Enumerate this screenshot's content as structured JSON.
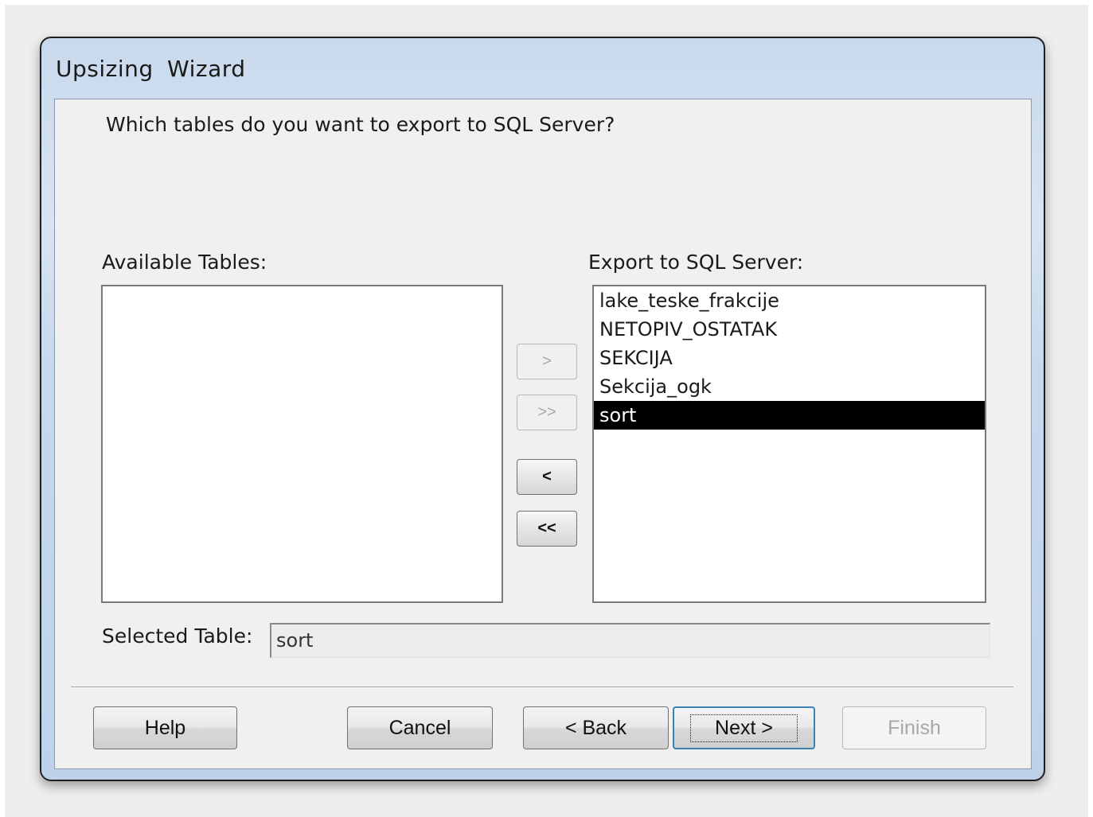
{
  "window": {
    "title": "Upsizing  Wizard"
  },
  "prompt": "Which tables do you want to export to SQL Server?",
  "available": {
    "label": "Available Tables:",
    "items": []
  },
  "export": {
    "label": "Export to SQL Server:",
    "items": [
      {
        "name": "lake_teske_frakcije",
        "selected": false
      },
      {
        "name": "NETOPIV_OSTATAK",
        "selected": false
      },
      {
        "name": "SEKCIJA",
        "selected": false
      },
      {
        "name": "Sekcija_ogk",
        "selected": false
      },
      {
        "name": "sort",
        "selected": true
      }
    ]
  },
  "move_buttons": {
    "add_one": ">",
    "add_all": ">>",
    "remove_one": "<",
    "remove_all": "<<"
  },
  "selected_table": {
    "label": "Selected Table:",
    "value": "sort"
  },
  "buttons": {
    "help": "Help",
    "cancel": "Cancel",
    "back": "< Back",
    "next": "Next >",
    "finish": "Finish"
  }
}
